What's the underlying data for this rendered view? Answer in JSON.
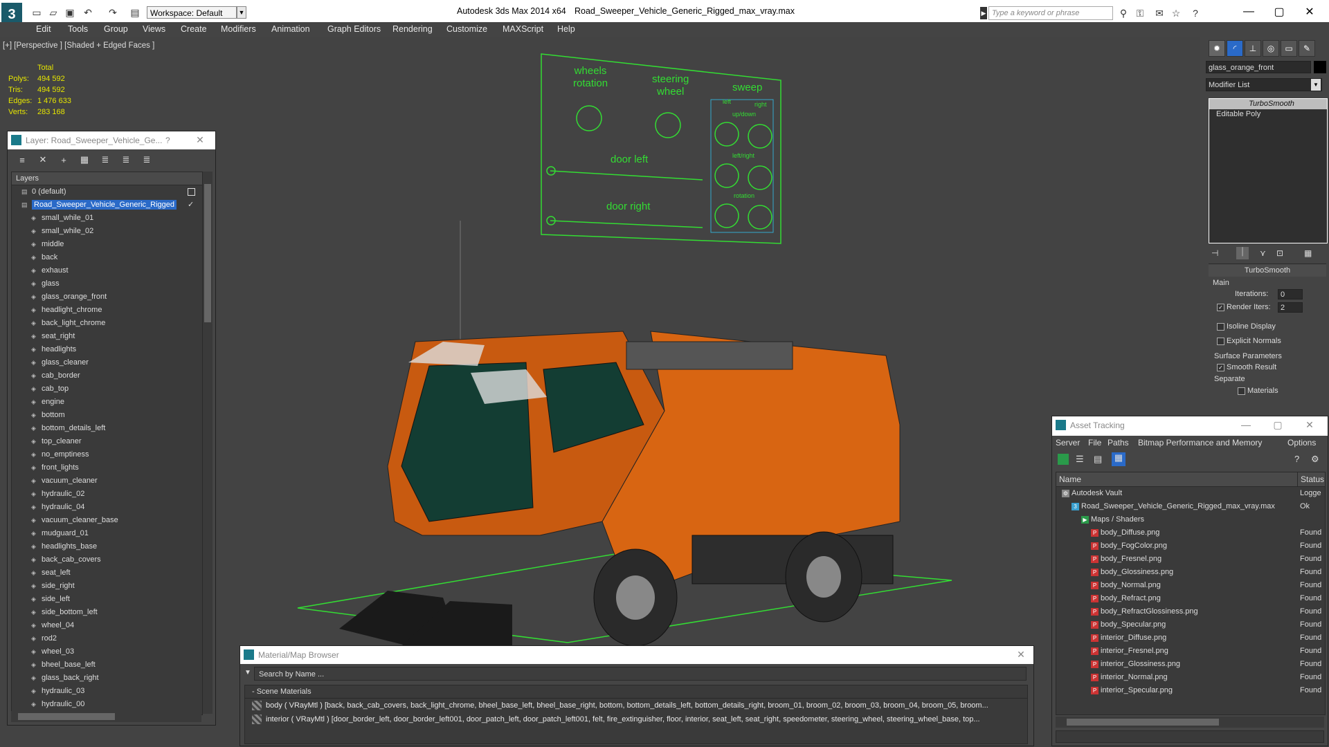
{
  "titlebar": {
    "app": "Autodesk 3ds Max  2014 x64",
    "file": "Road_Sweeper_Vehicle_Generic_Rigged_max_vray.max",
    "workspace": "Workspace: Default",
    "search_placeholder": "Type a keyword or phrase"
  },
  "menu": [
    "Edit",
    "Tools",
    "Group",
    "Views",
    "Create",
    "Modifiers",
    "Animation",
    "Graph Editors",
    "Rendering",
    "Customize",
    "MAXScript",
    "Help"
  ],
  "viewport": {
    "label": "[+] [Perspective ] [Shaded + Edged Faces ]",
    "stats": {
      "total_label": "Total",
      "rows": [
        {
          "k": "Polys:",
          "v": "494 592"
        },
        {
          "k": "Tris:",
          "v": "494 592"
        },
        {
          "k": "Edges:",
          "v": "1 476 633"
        },
        {
          "k": "Verts:",
          "v": "283 168"
        }
      ]
    },
    "rig": {
      "wheels_rotation": "wheels\nrotation",
      "steering_wheel": "steering\nwheel",
      "sweep": "sweep",
      "left": "left",
      "right": "right",
      "updown": "up/down",
      "leftright": "left/right",
      "rotation": "rotation",
      "door_left": "door left",
      "door_right": "door right"
    }
  },
  "layer_window": {
    "title": "Layer: Road_Sweeper_Vehicle_Ge...",
    "help": "?",
    "header": "Layers",
    "layers": [
      "0 (default)",
      "Road_Sweeper_Vehicle_Generic_Rigged",
      "small_while_01",
      "small_while_02",
      "middle",
      "back",
      "exhaust",
      "glass",
      "glass_orange_front",
      "headlight_chrome",
      "back_light_chrome",
      "seat_right",
      "headlights",
      "glass_cleaner",
      "cab_border",
      "cab_top",
      "engine",
      "bottom",
      "bottom_details_left",
      "top_cleaner",
      "no_emptiness",
      "front_lights",
      "vacuum_cleaner",
      "hydraulic_02",
      "hydraulic_04",
      "vacuum_cleaner_base",
      "mudguard_01",
      "headlights_base",
      "back_cab_covers",
      "seat_left",
      "side_right",
      "side_left",
      "side_bottom_left",
      "wheel_04",
      "rod2",
      "wheel_03",
      "bheel_base_left",
      "glass_back_right",
      "hydraulic_03",
      "hydraulic_00"
    ]
  },
  "command_panel": {
    "object_name": "glass_orange_front",
    "modifier_list": "Modifier List",
    "stack": [
      "TurboSmooth",
      "Editable Poly"
    ],
    "rollout": "TurboSmooth",
    "main_label": "Main",
    "iterations_label": "Iterations:",
    "iterations": "0",
    "render_iters_label": "Render Iters:",
    "render_iters": "2",
    "isoline": "Isoline Display",
    "explicit": "Explicit Normals",
    "surface_label": "Surface Parameters",
    "smooth_result": "Smooth Result",
    "separate_label": "Separate",
    "materials": "Materials"
  },
  "asset_window": {
    "title": "Asset Tracking",
    "menu": [
      "Server",
      "File",
      "Paths",
      "Bitmap Performance and Memory",
      "Options"
    ],
    "col_name": "Name",
    "col_status": "Status",
    "rows": [
      {
        "name": "Autodesk Vault",
        "status": "Logge",
        "indent": 1,
        "icon": "vault"
      },
      {
        "name": "Road_Sweeper_Vehicle_Generic_Rigged_max_vray.max",
        "status": "Ok",
        "indent": 2,
        "icon": "max"
      },
      {
        "name": "Maps / Shaders",
        "status": "",
        "indent": 3,
        "icon": "maps"
      },
      {
        "name": "body_Diffuse.png",
        "status": "Found",
        "indent": 4,
        "icon": "png"
      },
      {
        "name": "body_FogColor.png",
        "status": "Found",
        "indent": 4,
        "icon": "png"
      },
      {
        "name": "body_Fresnel.png",
        "status": "Found",
        "indent": 4,
        "icon": "png"
      },
      {
        "name": "body_Glossiness.png",
        "status": "Found",
        "indent": 4,
        "icon": "png"
      },
      {
        "name": "body_Normal.png",
        "status": "Found",
        "indent": 4,
        "icon": "png"
      },
      {
        "name": "body_Refract.png",
        "status": "Found",
        "indent": 4,
        "icon": "png"
      },
      {
        "name": "body_RefractGlossiness.png",
        "status": "Found",
        "indent": 4,
        "icon": "png"
      },
      {
        "name": "body_Specular.png",
        "status": "Found",
        "indent": 4,
        "icon": "png"
      },
      {
        "name": "interior_Diffuse.png",
        "status": "Found",
        "indent": 4,
        "icon": "png"
      },
      {
        "name": "interior_Fresnel.png",
        "status": "Found",
        "indent": 4,
        "icon": "png"
      },
      {
        "name": "interior_Glossiness.png",
        "status": "Found",
        "indent": 4,
        "icon": "png"
      },
      {
        "name": "interior_Normal.png",
        "status": "Found",
        "indent": 4,
        "icon": "png"
      },
      {
        "name": "interior_Specular.png",
        "status": "Found",
        "indent": 4,
        "icon": "png"
      }
    ]
  },
  "material_window": {
    "title": "Material/Map Browser",
    "search": "Search by Name ...",
    "group": "- Scene Materials",
    "materials": [
      "body ( VRayMtl ) [back, back_cab_covers, back_light_chrome, bheel_base_left, bheel_base_right, bottom, bottom_details_left, bottom_details_right, broom_01, broom_02, broom_03, broom_04, broom_05, broom...",
      "interior ( VRayMtl ) [door_border_left, door_border_left001, door_patch_left, door_patch_left001, felt, fire_extinguisher, floor, interior, seat_left, seat_right, speedometer, steering_wheel, steering_wheel_base, top..."
    ]
  },
  "colors": {
    "accent": "#2a6ac8",
    "rig": "#33dd33",
    "body": "#e06010",
    "stats": "#e6e600"
  }
}
